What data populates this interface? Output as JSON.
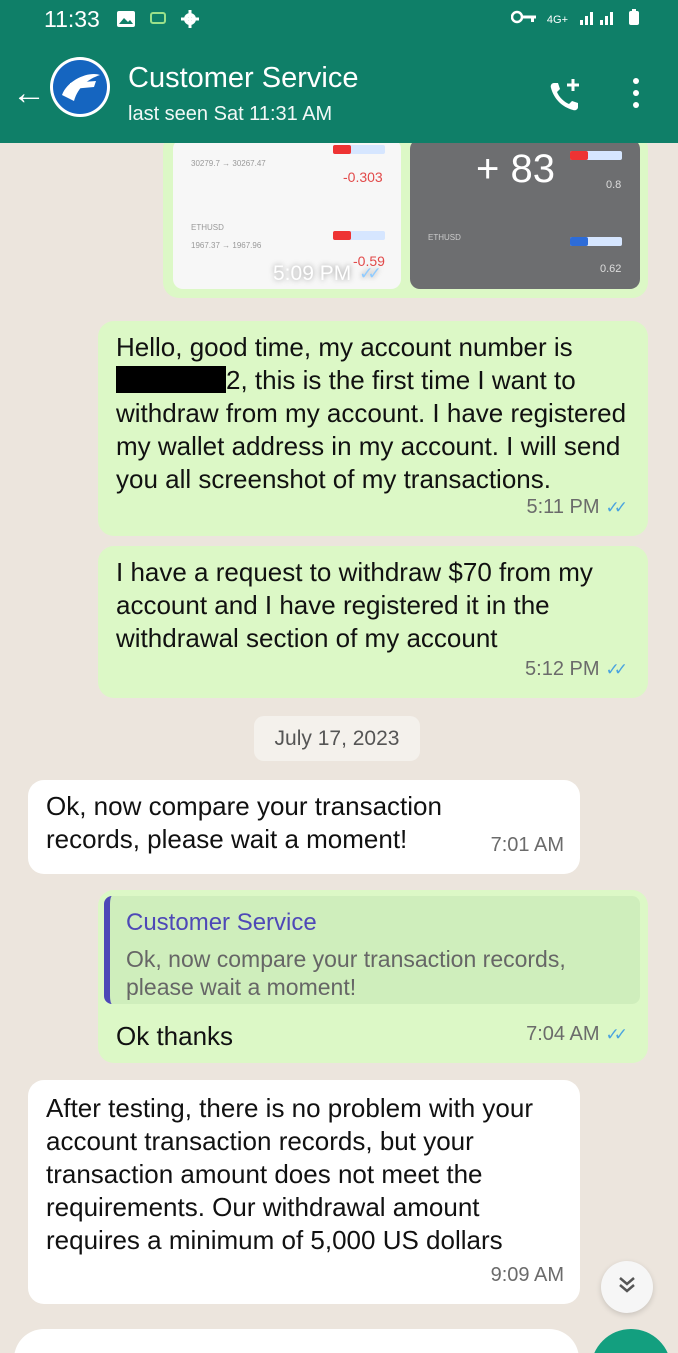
{
  "status_bar": {
    "time": "11:33",
    "network": "4G+"
  },
  "header": {
    "contact_name": "Customer Service",
    "last_seen": "last seen Sat 11:31 AM"
  },
  "album": {
    "more_count": "+ 83",
    "time": "5:09 PM",
    "left_thumb": {
      "row1_label": "30279.7 → 30267.47",
      "row1_value": "-0.303",
      "row2_symbol": "ETHUSD",
      "row2_label": "1967.37 → 1967.96",
      "row2_value": "-0.59"
    },
    "right_thumb": {
      "row1_value": "0.8",
      "row2_symbol": "ETHUSD",
      "row2_value": "0.62"
    }
  },
  "messages": [
    {
      "text_pre": "Hello, good time, my account number is",
      "text_post": "2, this is the first time I want to withdraw from my account.  I have registered my wallet address in my account.  I will send you all screenshot of my transactions.",
      "time": "5:11 PM"
    },
    {
      "text": "I have a request to withdraw $70 from my account and I have registered it in the withdrawal section of my account",
      "time": "5:12 PM"
    },
    {
      "date": "July 17, 2023"
    },
    {
      "text": "Ok, now compare your transaction records, please wait a moment!",
      "time": "7:01 AM"
    },
    {
      "quote_author": "Customer Service",
      "quote_text": "Ok, now compare your transaction records, please wait a moment!",
      "text": "Ok thanks",
      "time": "7:04 AM"
    },
    {
      "text": "After testing, there is no problem with your account transaction records, but your transaction amount does not meet the requirements. Our withdrawal amount requires a minimum of 5,000 US dollars",
      "time": "9:09 AM"
    }
  ],
  "colors": {
    "header": "#0f7f68",
    "outgoing": "#dcf8c6",
    "incoming": "#ffffff",
    "background": "#ece5dd",
    "read_ticks": "#4aa3df"
  }
}
